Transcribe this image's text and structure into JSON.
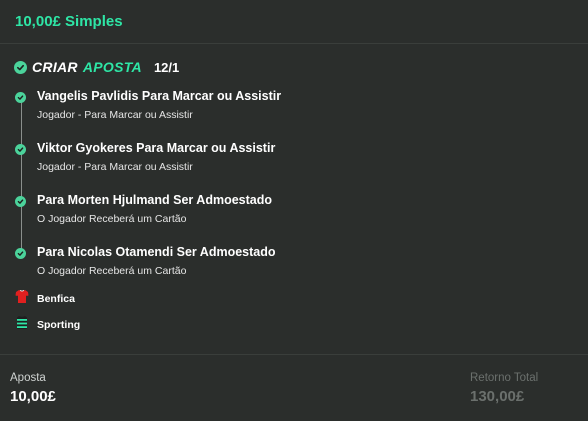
{
  "header": {
    "title": "10,00£ Simples"
  },
  "bet_builder": {
    "label_part1": "CRIAR",
    "label_part2": "APOSTA",
    "odds": "12/1",
    "selections": [
      {
        "title": "Vangelis Pavlidis Para Marcar ou Assistir",
        "subtitle": "Jogador - Para Marcar ou Assistir"
      },
      {
        "title": "Viktor Gyokeres Para Marcar ou Assistir",
        "subtitle": "Jogador - Para Marcar ou Assistir"
      },
      {
        "title": "Para Morten Hjulmand Ser Admoestado",
        "subtitle": "O Jogador Receberá um Cartão"
      },
      {
        "title": "Para Nicolas Otamendi Ser Admoestado",
        "subtitle": "O Jogador Receberá um Cartão"
      }
    ]
  },
  "teams": [
    {
      "name": "Benfica",
      "icon": "red-shirt-icon"
    },
    {
      "name": "Sporting",
      "icon": "striped-shirt-icon"
    }
  ],
  "footer": {
    "stake_label": "Aposta",
    "stake_value": "10,00£",
    "return_label": "Retorno Total",
    "return_value": "130,00£"
  },
  "colors": {
    "accent": "#2ee6a6",
    "check": "#4bd39b",
    "background": "#2b2e2c",
    "muted": "#6b706d"
  }
}
